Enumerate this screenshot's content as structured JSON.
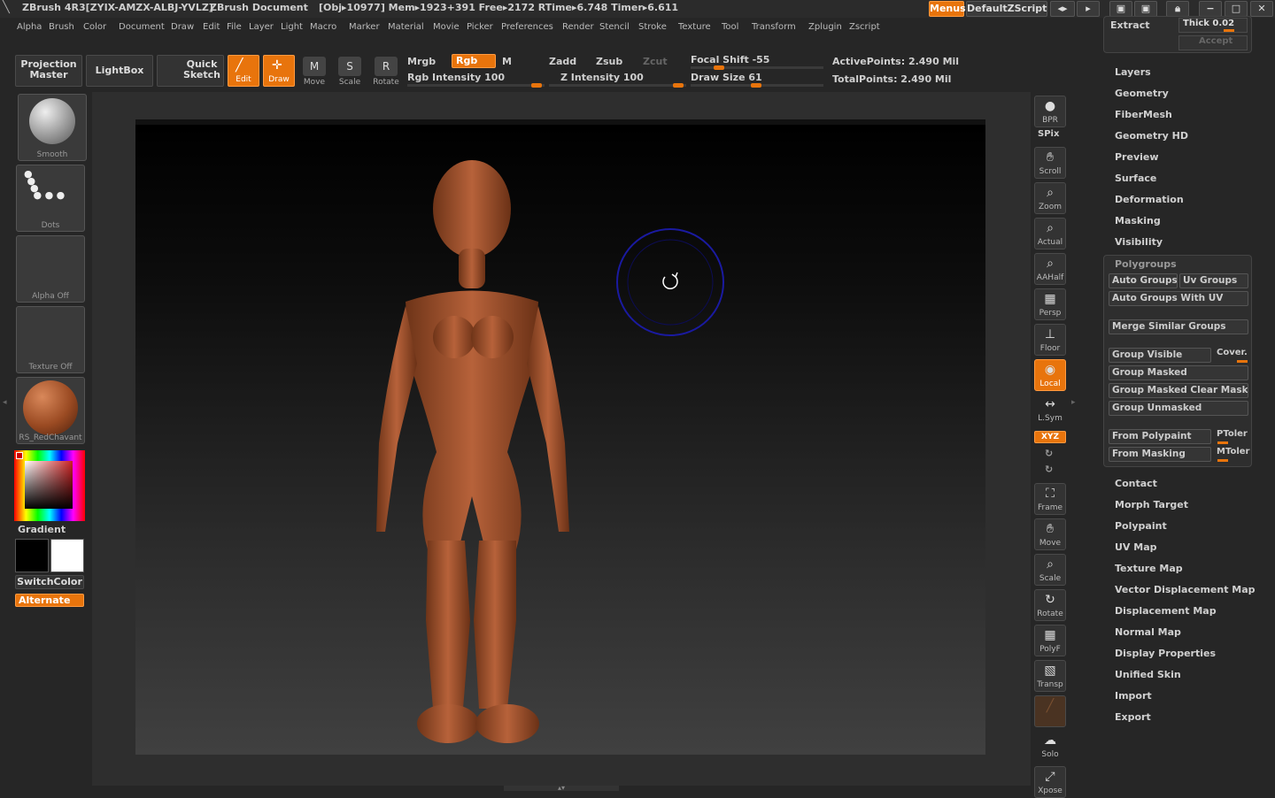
{
  "titlebar": {
    "app": "ZBrush 4R3[ZYIX-AMZX-ALBJ-YVLZ]",
    "document": "ZBrush Document",
    "stats": "[Obj▸10977] Mem▸1923+391 Free▸2172 RTime▸6.748 Timer▸6.611",
    "menus_btn": "Menus",
    "script_btn": "DefaultZScript"
  },
  "menubar": [
    "Alpha",
    "Brush",
    "Color",
    "Document",
    "Draw",
    "Edit",
    "File",
    "Layer",
    "Light",
    "Macro",
    "Marker",
    "Material",
    "Movie",
    "Picker",
    "Preferences",
    "Render",
    "Stencil",
    "Stroke",
    "Texture",
    "Tool",
    "Transform",
    "Zplugin",
    "Zscript"
  ],
  "toolbar": {
    "projection_master": "Projection Master",
    "lightbox": "LightBox",
    "quick_sketch": "Quick Sketch",
    "edit": "Edit",
    "draw": "Draw",
    "move": "Move",
    "scale": "Scale",
    "rotate": "Rotate",
    "mrgb": "Mrgb",
    "rgb": "Rgb",
    "m": "M",
    "zadd": "Zadd",
    "zsub": "Zsub",
    "zcut": "Zcut",
    "rgb_intensity": "Rgb Intensity 100",
    "rgb_intensity_value": 100,
    "z_intensity": "Z Intensity 100",
    "z_intensity_value": 100,
    "focal_shift": "Focal Shift -55",
    "focal_shift_value": -55,
    "draw_size": "Draw Size 61",
    "draw_size_value": 61,
    "active_points": "ActivePoints: 2.490 Mil",
    "total_points": "TotalPoints: 2.490 Mil"
  },
  "leftpanel": {
    "brush": "Smooth",
    "stroke": "Dots",
    "alpha": "Alpha Off",
    "texture": "Texture Off",
    "material": "RS_RedChavant",
    "gradient": "Gradient",
    "switchcolor": "SwitchColor",
    "alternate": "Alternate",
    "main_color": "#000000",
    "secondary_color": "#ffffff"
  },
  "rightshelf": [
    "BPR",
    "SPix",
    "Scroll",
    "Zoom",
    "Actual",
    "AAHalf",
    "Persp",
    "Floor",
    "Local",
    "L.Sym",
    "XYZ",
    "Frame",
    "Move",
    "Scale",
    "Rotate",
    "PolyF",
    "Transp",
    "Solo",
    "Xpose"
  ],
  "tray": {
    "extract": "Extract",
    "thick": "Thick 0.02",
    "accept": "Accept",
    "subpalettes_top": [
      "Layers",
      "Geometry",
      "FiberMesh",
      "Geometry HD",
      "Preview",
      "Surface",
      "Deformation",
      "Masking",
      "Visibility"
    ],
    "polygroups": {
      "title": "Polygroups",
      "auto_groups": "Auto Groups",
      "uv_groups": "Uv Groups",
      "auto_groups_uv": "Auto Groups With UV",
      "merge_similar": "Merge Similar Groups",
      "group_visible": "Group Visible",
      "coverage": "Cover.",
      "group_masked": "Group Masked",
      "group_masked_clear": "Group Masked Clear Mask",
      "group_unmasked": "Group Unmasked",
      "from_polypaint": "From Polypaint",
      "ptoler": "PToler",
      "from_masking": "From Masking",
      "mtoler": "MToler"
    },
    "subpalettes_bottom": [
      "Contact",
      "Morph Target",
      "Polypaint",
      "UV Map",
      "Texture Map",
      "Vector Displacement Map",
      "Displacement Map",
      "Normal Map",
      "Display Properties",
      "Unified Skin",
      "Import",
      "Export"
    ]
  }
}
